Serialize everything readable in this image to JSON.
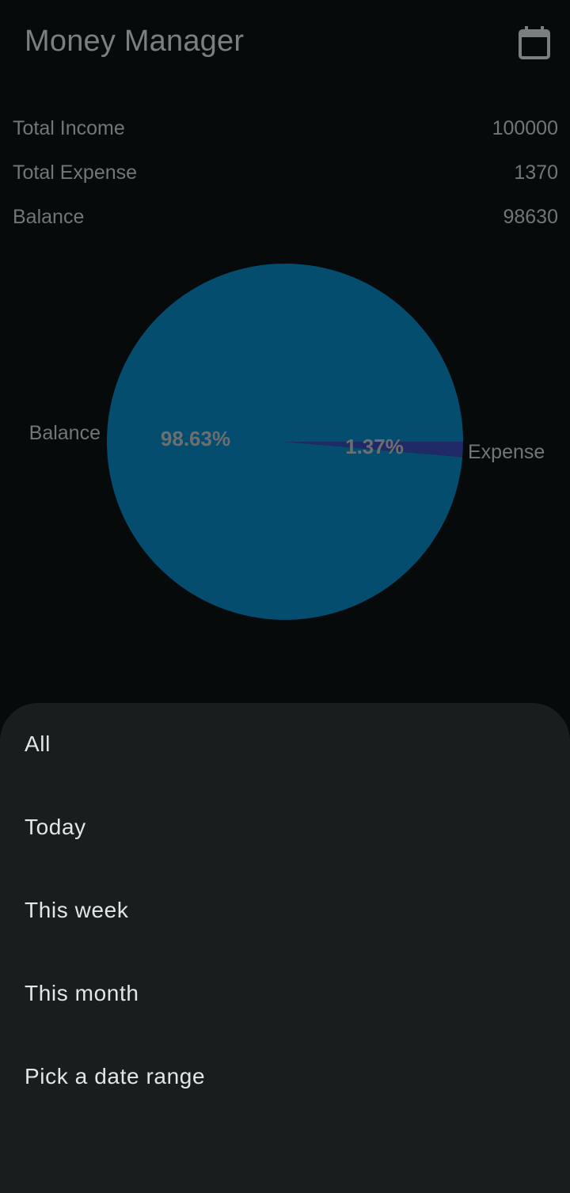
{
  "app_bar": {
    "title": "Money Manager",
    "calendar_icon": "calendar-icon"
  },
  "summary": [
    {
      "label": "Total Income",
      "value": "100000"
    },
    {
      "label": "Total Expense",
      "value": "1370"
    },
    {
      "label": "Balance",
      "value": "98630"
    }
  ],
  "chart_data": {
    "type": "pie",
    "slices": [
      {
        "label": "Balance",
        "value": 98630,
        "percent_label": "98.63%",
        "color": "#044d6f"
      },
      {
        "label": "Expense",
        "value": 1370,
        "percent_label": "1.37%",
        "color": "#1f2a66"
      }
    ]
  },
  "date_filter_sheet": {
    "options": [
      "All",
      "Today",
      "This week",
      "This month",
      "Pick a date range"
    ]
  },
  "colors": {
    "background": "#070a0b",
    "sheet": "#181d1e",
    "muted_text": "#727677",
    "sheet_text": "#e3e6e6"
  }
}
